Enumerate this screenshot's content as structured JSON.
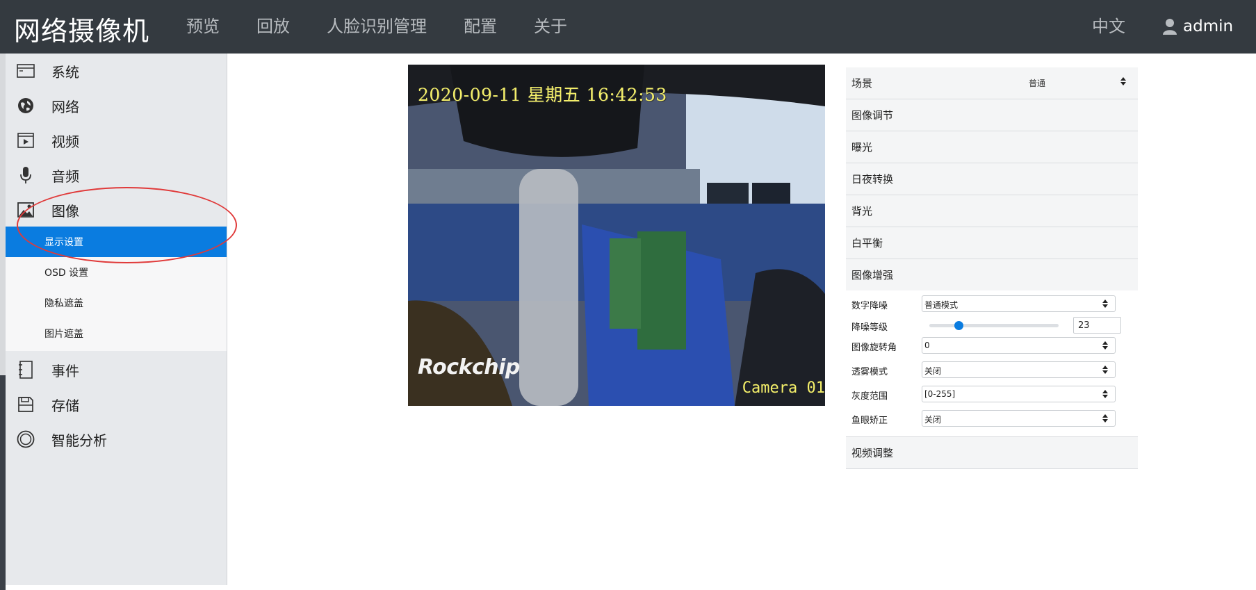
{
  "header": {
    "title": "网络摄像机",
    "nav": [
      "预览",
      "回放",
      "人脸识别管理",
      "配置",
      "关于"
    ],
    "language": "中文",
    "user": "admin"
  },
  "sidebar": {
    "items": [
      {
        "label": "系统",
        "icon": "system-icon"
      },
      {
        "label": "网络",
        "icon": "globe-icon"
      },
      {
        "label": "视频",
        "icon": "video-icon"
      },
      {
        "label": "音频",
        "icon": "microphone-icon"
      },
      {
        "label": "图像",
        "icon": "image-icon"
      },
      {
        "label": "事件",
        "icon": "notebook-icon"
      },
      {
        "label": "存储",
        "icon": "floppy-icon"
      },
      {
        "label": "智能分析",
        "icon": "target-icon"
      }
    ],
    "subitems": [
      "显示设置",
      "OSD 设置",
      "隐私遮盖",
      "图片遮盖"
    ],
    "active_subitem": "显示设置"
  },
  "preview": {
    "osd_time": "2020-09-11 星期五 16:42:53",
    "osd_camera": "Camera 01",
    "logo": "Rockchip"
  },
  "settings": {
    "scene": {
      "label": "场景",
      "value": "普通"
    },
    "sections": [
      "图像调节",
      "曝光",
      "日夜转换",
      "背光",
      "白平衡",
      "图像增强"
    ],
    "enhance": {
      "dnr": {
        "label": "数字降噪",
        "value": "普通模式"
      },
      "dnr_level": {
        "label": "降噪等级",
        "value": "23",
        "fraction": 0.23
      },
      "rotation": {
        "label": "图像旋转角",
        "value": "0"
      },
      "defog": {
        "label": "透雾模式",
        "value": "关闭"
      },
      "gray_range": {
        "label": "灰度范围",
        "value": "[0-255]"
      },
      "fisheye": {
        "label": "鱼眼矫正",
        "value": "关闭"
      }
    },
    "video_adjust": "视频调整"
  },
  "colors": {
    "topbar": "#343a40",
    "accent": "#0a7ce0",
    "osd_text": "#f5f06a",
    "annotation": "#e03a3a"
  }
}
